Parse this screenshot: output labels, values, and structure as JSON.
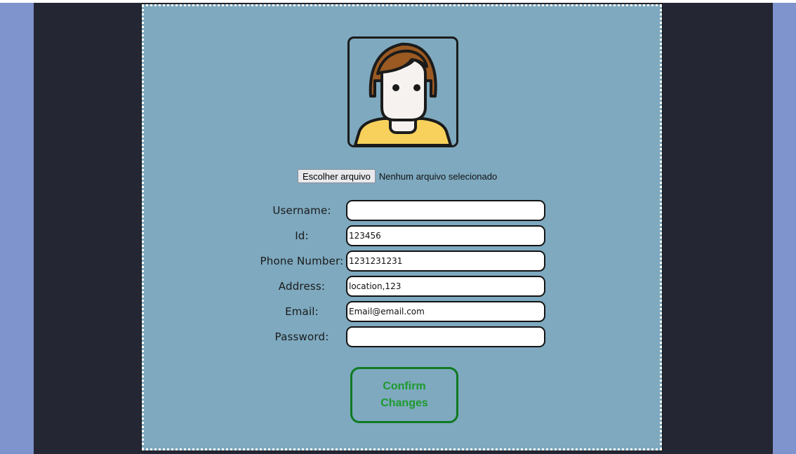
{
  "file_upload": {
    "button_label": "Escolher arquivo",
    "status_text": "Nenhum arquivo selecionado"
  },
  "form": {
    "fields": [
      {
        "label": "Username:",
        "value": ""
      },
      {
        "label": "Id:",
        "value": "123456"
      },
      {
        "label": "Phone Number:",
        "value": "1231231231"
      },
      {
        "label": "Address:",
        "value": "location,123"
      },
      {
        "label": "Email:",
        "value": "Email@email.com"
      },
      {
        "label": "Password:",
        "value": ""
      }
    ]
  },
  "confirm_button": {
    "label": "Confirm Changes"
  },
  "colors": {
    "outer_background": "#7f93cd",
    "stage_background": "#242633",
    "panel_background": "#7ea9bf",
    "avatar_hair": "#9a5a22",
    "avatar_shirt": "#f7d15b",
    "confirm_accent": "#1d9a2d"
  },
  "icons": {
    "avatar": "user-avatar-icon"
  }
}
